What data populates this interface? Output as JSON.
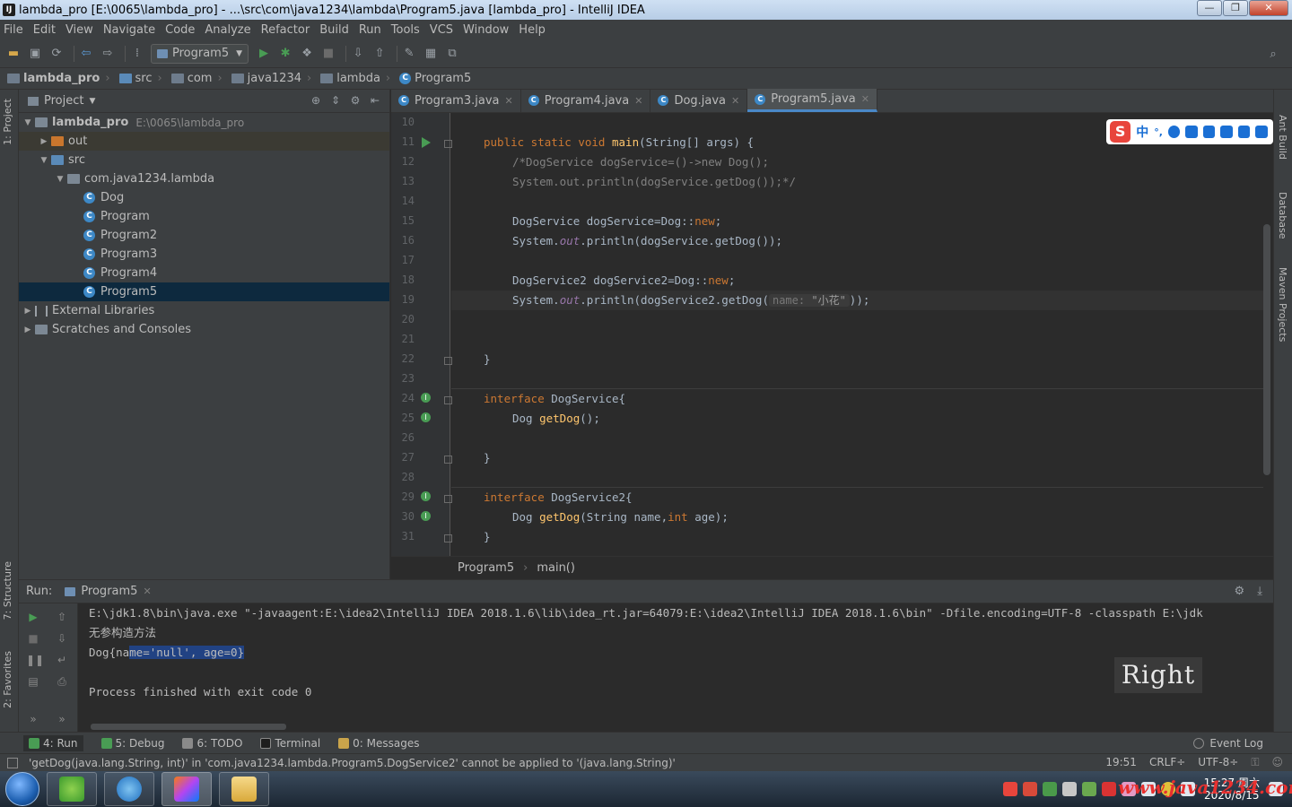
{
  "window": {
    "title": "lambda_pro [E:\\0065\\lambda_pro] - ...\\src\\com\\java1234\\lambda\\Program5.java [lambda_pro] - IntelliJ IDEA",
    "controls": [
      "—",
      "❐",
      "✕"
    ]
  },
  "menu": [
    "File",
    "Edit",
    "View",
    "Navigate",
    "Code",
    "Analyze",
    "Refactor",
    "Build",
    "Run",
    "Tools",
    "VCS",
    "Window",
    "Help"
  ],
  "toolbar": {
    "run_config": "Program5"
  },
  "breadcrumbs": [
    "lambda_pro",
    "src",
    "com",
    "java1234",
    "lambda",
    "Program5"
  ],
  "left_tool_windows": [
    "1: Project",
    "7: Structure",
    "2: Favorites"
  ],
  "right_tool_windows": [
    "Ant Build",
    "Database",
    "Maven Projects"
  ],
  "project": {
    "header": "Project",
    "tree": [
      {
        "label": "lambda_pro",
        "path": "E:\\0065\\lambda_pro",
        "depth": 0,
        "expanded": true,
        "kind": "module"
      },
      {
        "label": "out",
        "depth": 1,
        "expanded": false,
        "kind": "folder-orange"
      },
      {
        "label": "src",
        "depth": 1,
        "expanded": true,
        "kind": "folder-blue"
      },
      {
        "label": "com.java1234.lambda",
        "depth": 2,
        "expanded": true,
        "kind": "package"
      },
      {
        "label": "Dog",
        "depth": 3,
        "kind": "class"
      },
      {
        "label": "Program",
        "depth": 3,
        "kind": "class"
      },
      {
        "label": "Program2",
        "depth": 3,
        "kind": "class"
      },
      {
        "label": "Program3",
        "depth": 3,
        "kind": "class"
      },
      {
        "label": "Program4",
        "depth": 3,
        "kind": "class"
      },
      {
        "label": "Program5",
        "depth": 3,
        "kind": "class",
        "selected": true
      },
      {
        "label": "External Libraries",
        "depth": 0,
        "expanded": false,
        "kind": "lib"
      },
      {
        "label": "Scratches and Consoles",
        "depth": 0,
        "expanded": false,
        "kind": "scratch"
      }
    ]
  },
  "editor": {
    "tabs": [
      {
        "label": "Program3.java",
        "active": false
      },
      {
        "label": "Program4.java",
        "active": false
      },
      {
        "label": "Dog.java",
        "active": false
      },
      {
        "label": "Program5.java",
        "active": true
      }
    ],
    "line_numbers": [
      "10",
      "11",
      "12",
      "13",
      "14",
      "15",
      "16",
      "17",
      "18",
      "19",
      "20",
      "21",
      "22",
      "23",
      "24",
      "25",
      "26",
      "27",
      "28",
      "29",
      "30",
      "31"
    ],
    "code": {
      "l11_kw": "public static void ",
      "l11_fn": "main",
      "l11_rest": "(String[] args) {",
      "l12": "/*DogService dogService=()->new Dog();",
      "l13": "System.out.println(dogService.getDog());*/",
      "l15_a": "DogService dogService=Dog::",
      "l15_kw": "new",
      "l15_b": ";",
      "l16_a": "System.",
      "l16_out": "out",
      "l16_b": ".println(dogService.getDog());",
      "l18_a": "DogService2 dogService2=Dog::",
      "l18_kw": "new",
      "l18_b": ";",
      "l19_a": "System.",
      "l19_out": "out",
      "l19_b": ".println(dogService2.getDog(",
      "l19_hint": "name:",
      "l19_str": "\"小花\"",
      "l19_c": "));",
      "l22": "}",
      "l24_kw": "interface ",
      "l24_rest": "DogService{",
      "l25_a": "Dog ",
      "l25_fn": "getDog",
      "l25_b": "();",
      "l27": "}",
      "l29_kw": "interface ",
      "l29_rest": "DogService2{",
      "l30_a": "Dog ",
      "l30_fn": "getDog",
      "l30_b": "(String name,",
      "l30_kw": "int",
      "l30_c": " age);",
      "l31": "}"
    },
    "crumbs": [
      "Program5",
      "main()"
    ]
  },
  "ime": {
    "mode": "中",
    "punct": "°,"
  },
  "run": {
    "label": "Run:",
    "tab": "Program5",
    "console": {
      "cmd": "E:\\jdk1.8\\bin\\java.exe \"-javaagent:E:\\idea2\\IntelliJ IDEA 2018.1.6\\lib\\idea_rt.jar=64079:E:\\idea2\\IntelliJ IDEA 2018.1.6\\bin\" -Dfile.encoding=UTF-8 -classpath E:\\jdk",
      "line2": "无参构造方法",
      "line3_a": "Dog{na",
      "line3_sel": "me='null', age=0}",
      "line5": "Process finished with exit code 0"
    },
    "overlay": "Right"
  },
  "tool_tabs": [
    {
      "label": "4: Run",
      "active": true
    },
    {
      "label": "5: Debug",
      "active": false
    },
    {
      "label": "6: TODO",
      "active": false
    },
    {
      "label": "Terminal",
      "active": false
    },
    {
      "label": "0: Messages",
      "active": false
    }
  ],
  "event_log": "Event Log",
  "status": {
    "message": "'getDog(java.lang.String, int)' in 'com.java1234.lambda.Program5.DogService2' cannot be applied to '(java.lang.String)'",
    "position": "19:51",
    "line_sep": "CRLF÷",
    "encoding": "UTF-8÷"
  },
  "taskbar": {
    "time": "15:27 周六",
    "date": "2020/8/15",
    "watermark": "www.java1234.com"
  }
}
